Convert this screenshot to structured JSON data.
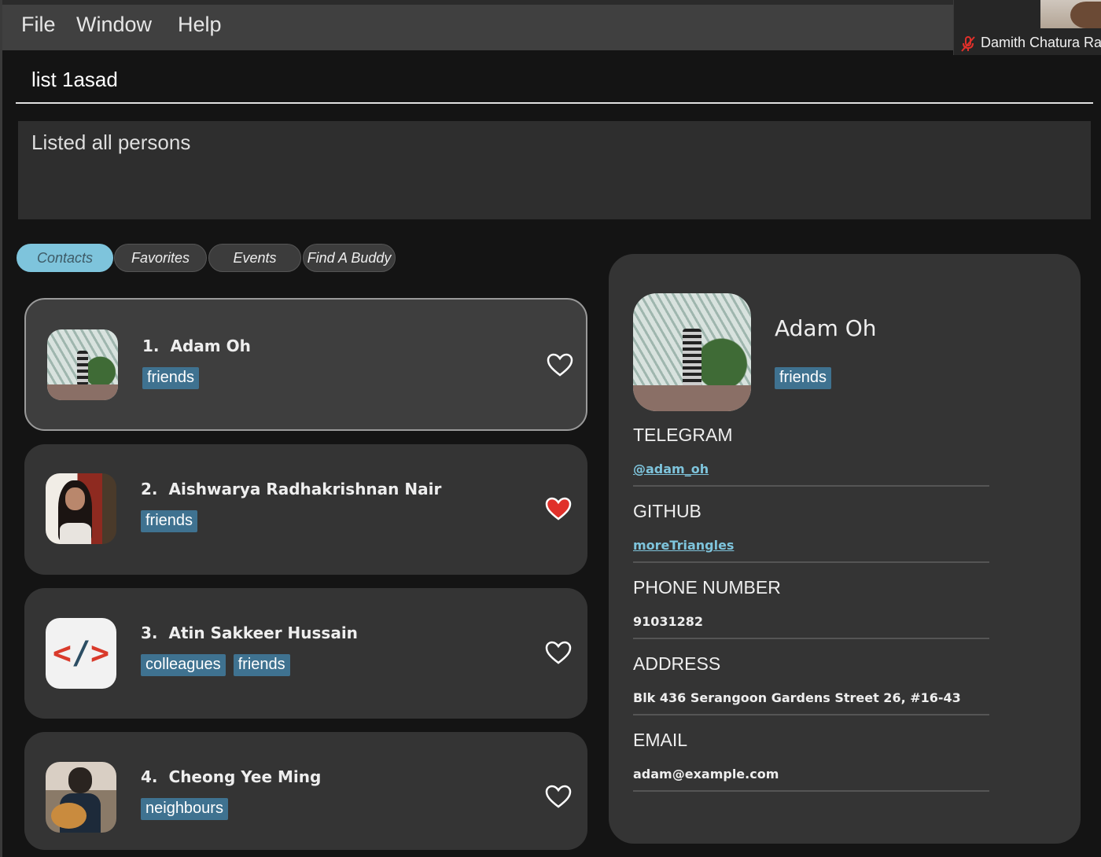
{
  "menu": {
    "file": "File",
    "window": "Window",
    "help": "Help"
  },
  "zoom": {
    "participant_name": "Damith Chatura Ra",
    "mic_icon": "muted-mic-icon"
  },
  "command": {
    "value": "list 1asad"
  },
  "result": {
    "text": "Listed all persons"
  },
  "tabs": [
    {
      "label": "Contacts",
      "active": true
    },
    {
      "label": "Favorites",
      "active": false
    },
    {
      "label": "Events",
      "active": false
    },
    {
      "label": "Find A Buddy",
      "active": false
    }
  ],
  "contacts": [
    {
      "index": "1.",
      "name": "Adam Oh",
      "tags": [
        "friends"
      ],
      "favorite": false,
      "selected": true
    },
    {
      "index": "2.",
      "name": "Aishwarya Radhakrishnan Nair",
      "tags": [
        "friends"
      ],
      "favorite": true,
      "selected": false
    },
    {
      "index": "3.",
      "name": "Atin Sakkeer Hussain",
      "tags": [
        "colleagues",
        "friends"
      ],
      "favorite": false,
      "selected": false
    },
    {
      "index": "4.",
      "name": "Cheong Yee Ming",
      "tags": [
        "neighbours"
      ],
      "favorite": false,
      "selected": false
    }
  ],
  "detail": {
    "name": "Adam Oh",
    "tags": [
      "friends"
    ],
    "telegram_label": "TELEGRAM",
    "telegram_value": "@adam_oh",
    "github_label": "GITHUB",
    "github_value": "moreTriangles",
    "phone_label": "PHONE NUMBER",
    "phone_value": "91031282",
    "address_label": "ADDRESS",
    "address_value": "Blk 436 Serangoon Gardens Street 26, #16-43",
    "email_label": "EMAIL",
    "email_value": "adam@example.com"
  },
  "colors": {
    "tag_bg": "#3f7290",
    "active_tab": "#7ec4dc",
    "heart_favorite": "#e0302a"
  }
}
